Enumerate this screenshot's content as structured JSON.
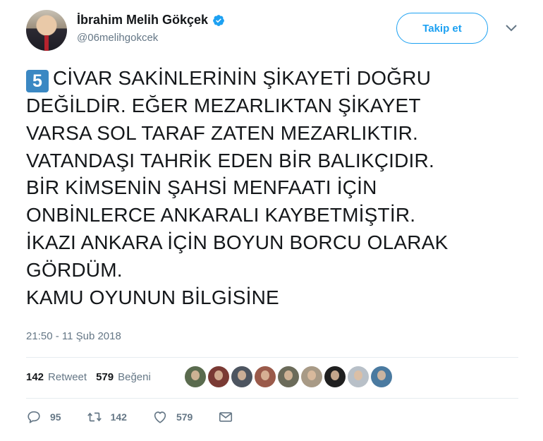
{
  "user": {
    "name": "İbrahim Melih Gökçek",
    "handle": "@06melihgokcek"
  },
  "follow_button": {
    "label": "Takip et"
  },
  "tweet": {
    "keycap": "5",
    "text": "CİVAR SAKİNLERİNİN ŞİKAYETİ DOĞRU\nDEĞİLDİR. EĞER MEZARLIKTAN ŞİKAYET\nVARSA SOL TARAF ZATEN MEZARLIKTIR.\nVATANDAŞI TAHRİK EDEN BİR BALIKÇIDIR.\nBİR KİMSENİN ŞAHSİ MENFAATI İÇİN\nONBİNLERCE ANKARALI KAYBETMİŞTİR.\nİKAZI ANKARA İÇİN BOYUN BORCU OLARAK\nGÖRDÜM.\nKAMU OYUNUN BİLGİSİNE",
    "timestamp": "21:50 - 11 Şub 2018"
  },
  "stats": {
    "retweet_count": "142",
    "retweet_label": "Retweet",
    "like_count": "579",
    "like_label": "Beğeni"
  },
  "likers": [
    {
      "color": "#5a6b4e"
    },
    {
      "color": "#7a3a34"
    },
    {
      "color": "#4d5560"
    },
    {
      "color": "#9a5a4a"
    },
    {
      "color": "#6b6b5a"
    },
    {
      "color": "#a89a86"
    },
    {
      "color": "#1f1f1f"
    },
    {
      "color": "#b8c0c8"
    },
    {
      "color": "#4a7aa0"
    }
  ],
  "actions": {
    "reply_count": "95",
    "retweet_count": "142",
    "like_count": "579"
  },
  "colors": {
    "accent": "#1da1f2",
    "secondary_text": "#657786",
    "keycap": "#3b88c3"
  }
}
